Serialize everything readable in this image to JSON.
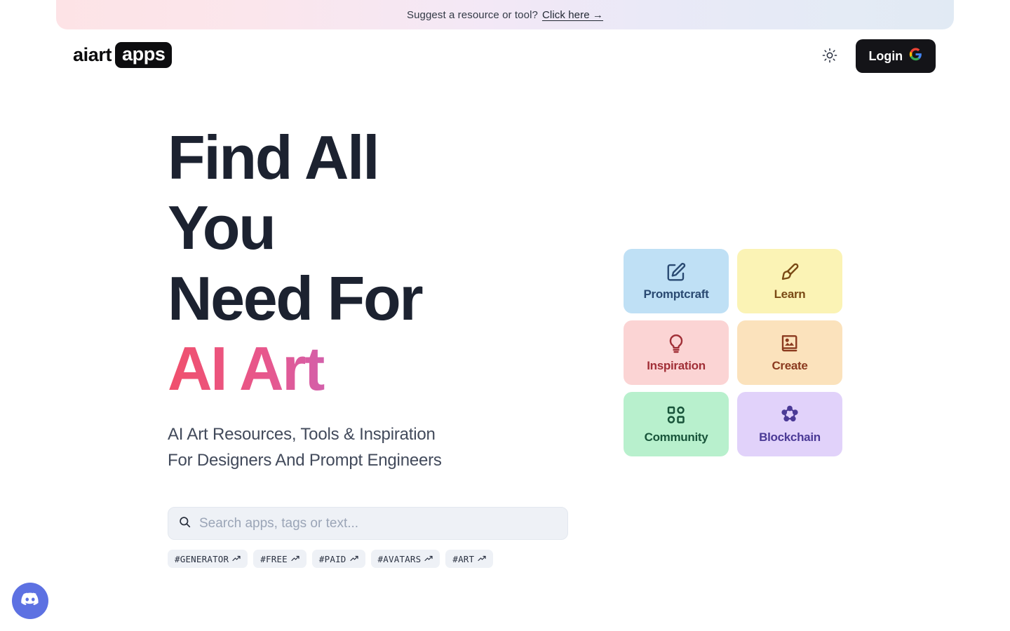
{
  "banner": {
    "text": "Suggest a resource or tool?",
    "link_label": "Click here →"
  },
  "header": {
    "logo_word": "aiart",
    "logo_badge": "apps",
    "theme_toggle_icon": "sun-icon",
    "login_label": "Login",
    "login_provider_icon": "google-g-icon"
  },
  "hero": {
    "line1": "Find All",
    "line2": "You",
    "line3": "Need For",
    "accent": "AI Art",
    "subtitle_line1": "AI Art Resources, Tools & Inspiration",
    "subtitle_line2": "For Designers And Prompt Engineers"
  },
  "search": {
    "icon": "search-icon",
    "value": "",
    "placeholder": "Search apps, tags or text..."
  },
  "tags": [
    {
      "label": "#GENERATOR",
      "icon": "trending-up-icon"
    },
    {
      "label": "#FREE",
      "icon": "trending-up-icon"
    },
    {
      "label": "#PAID",
      "icon": "trending-up-icon"
    },
    {
      "label": "#AVATARS",
      "icon": "trending-up-icon"
    },
    {
      "label": "#ART",
      "icon": "trending-up-icon"
    }
  ],
  "categories": {
    "left_column": [
      {
        "label": "Promptcraft",
        "icon": "edit-square-icon",
        "bg": "#bfe0f5",
        "fg": "#2a4a72"
      },
      {
        "label": "Inspiration",
        "icon": "lightbulb-icon",
        "bg": "#fbd4d4",
        "fg": "#a12f37"
      },
      {
        "label": "Community",
        "icon": "grid-shapes-icon",
        "bg": "#b8f0cd",
        "fg": "#18543a"
      }
    ],
    "right_column": [
      {
        "label": "Learn",
        "icon": "paintbrush-icon",
        "bg": "#fbf3b5",
        "fg": "#7a4a15"
      },
      {
        "label": "Create",
        "icon": "image-book-icon",
        "bg": "#fbe2bc",
        "fg": "#8b3a1f"
      },
      {
        "label": "Blockchain",
        "icon": "blockchain-nodes-icon",
        "bg": "#e1d2fa",
        "fg": "#4b3a96"
      }
    ]
  },
  "floating": {
    "discord_label": "Discord",
    "discord_icon": "discord-icon",
    "discord_color": "#5d71e2"
  }
}
